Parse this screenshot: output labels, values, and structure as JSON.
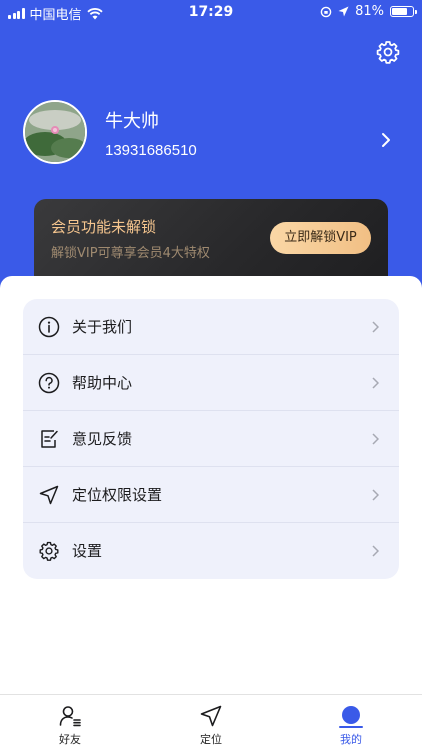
{
  "status_bar": {
    "carrier": "中国电信",
    "time": "17:29",
    "battery": "81%",
    "battery_level": 0.81
  },
  "profile": {
    "name": "牛大帅",
    "phone": "13931686510"
  },
  "vip": {
    "title": "会员功能未解锁",
    "subtitle": "解锁VIP可尊享会员4大特权",
    "button_label": "立即解锁VIP"
  },
  "menu": {
    "items": [
      {
        "label": "关于我们",
        "icon": "info-icon"
      },
      {
        "label": "帮助中心",
        "icon": "question-icon"
      },
      {
        "label": "意见反馈",
        "icon": "feedback-icon"
      },
      {
        "label": "定位权限设置",
        "icon": "location-arrow-icon"
      },
      {
        "label": "设置",
        "icon": "gear-icon"
      }
    ]
  },
  "tabs": [
    {
      "label": "好友",
      "icon": "friends-icon",
      "active": false
    },
    {
      "label": "定位",
      "icon": "location-arrow-icon",
      "active": false
    },
    {
      "label": "我的",
      "icon": "profile-dot-icon",
      "active": true
    }
  ],
  "colors": {
    "accent": "#3a5ae8",
    "vip_gold": "#f5c58e",
    "menu_bg": "#eff1fb"
  }
}
